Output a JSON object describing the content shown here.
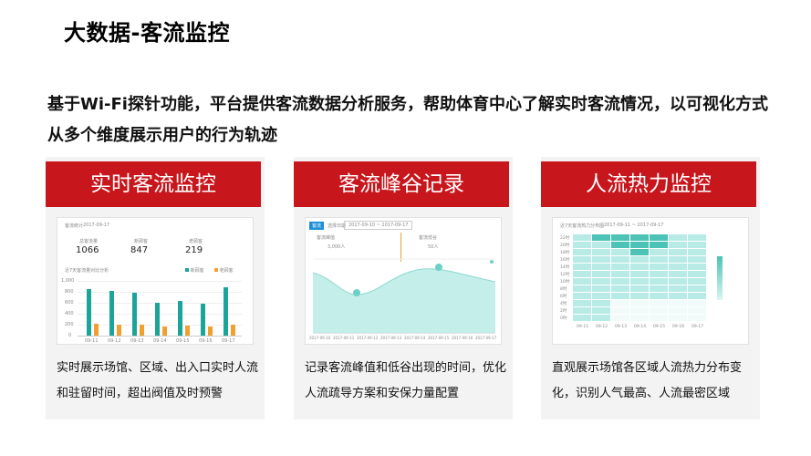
{
  "page": {
    "title": "大数据-客流监控",
    "intro": "基于Wi-Fi探针功能，平台提供客流数据分析服务，帮助体育中心了解实时客流情况，以可视化方式从多个维度展示用户的行为轨迹"
  },
  "colors": {
    "accent": "#c8161d",
    "teal": "#1aa49a",
    "orange": "#f0a030",
    "heat_light": "#b8ebe6",
    "heat_dark": "#4cc3b6"
  },
  "cards": [
    {
      "title": "实时客流监控",
      "description": "实时展示场馆、区域、出入口实时人流和驻留时间，超出阀值及时预警",
      "mockup": {
        "header": "客流统计",
        "date": "2017-09-17",
        "stats": [
          {
            "label": "总客流量",
            "value": "1066"
          },
          {
            "label": "新顾客",
            "value": "847"
          },
          {
            "label": "老顾客",
            "value": "219"
          }
        ],
        "chart_title": "近7天客流量对比分析",
        "legend": [
          "新顾客",
          "老顾客"
        ],
        "y_ticks": [
          "1,000",
          "800",
          "600",
          "400",
          "200",
          "0"
        ],
        "x_labels": [
          "09-11",
          "09-12",
          "09-13",
          "09-14",
          "09-15",
          "09-16",
          "09-17"
        ],
        "series_new": [
          0.85,
          0.82,
          0.78,
          0.6,
          0.63,
          0.58,
          0.88
        ],
        "series_old": [
          0.22,
          0.2,
          0.2,
          0.16,
          0.18,
          0.17,
          0.2
        ]
      }
    },
    {
      "title": "客流峰谷记录",
      "description": "记录客流峰值和低谷出现的时间，优化人流疏导方案和安保力量配置",
      "mockup": {
        "tag": "客流",
        "range_label": "选择日期",
        "range_value": "2017-09-10 ~ 2017-09-17",
        "peak_label": "客流峰值",
        "valley_label": "客流低谷",
        "peak_value": "3,000人",
        "valley_value": "50人",
        "x_labels": [
          "2017-09-10",
          "2017-09-11",
          "2017-09-12",
          "2017-09-13",
          "2017-09-14",
          "2017-09-15",
          "2017-09-16",
          "2017-09-17"
        ]
      }
    },
    {
      "title": "人流热力监控",
      "description": "直观展示场馆各区域人流热力分布变化，识别人气最高、人流最密区域",
      "mockup": {
        "title": "近7天客流热力分布图",
        "date": "2017-09-11 ~ 2017-09-17",
        "hours": [
          "22时",
          "20时",
          "18时",
          "16时",
          "14时",
          "12时",
          "10时",
          "8时",
          "6时",
          "4时",
          "2时",
          "0时"
        ],
        "days": [
          "09-11",
          "09-12",
          "09-13",
          "09-14",
          "09-15",
          "09-16",
          "09-17"
        ]
      }
    }
  ]
}
